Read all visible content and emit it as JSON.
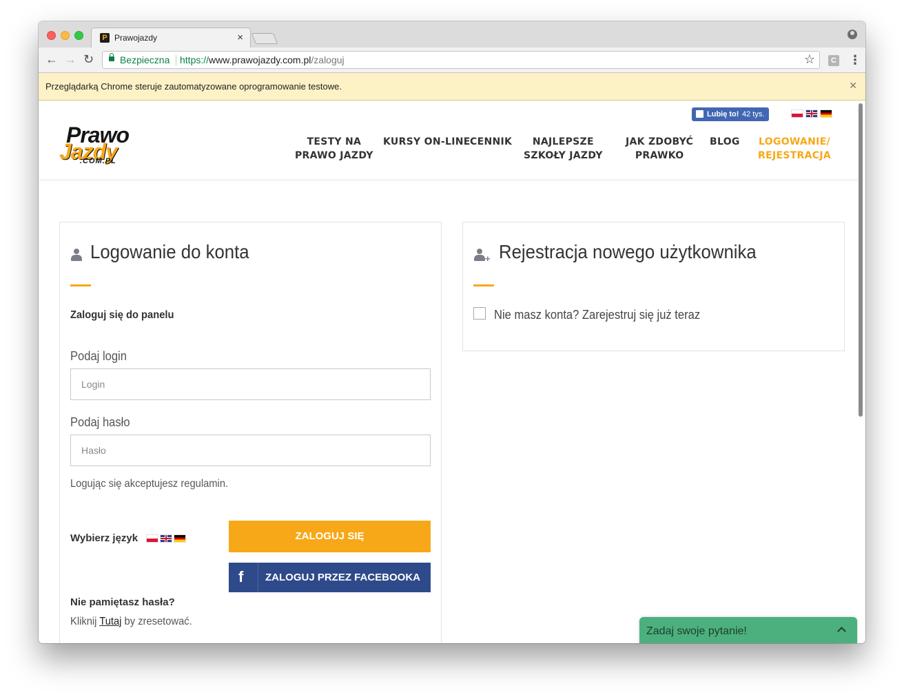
{
  "browser": {
    "tab_title": "Prawojazdy",
    "favicon_letter": "P",
    "secure_label": "Bezpieczna",
    "url_scheme": "https://",
    "url_host": "www.prawojazdy.com.pl",
    "url_path": "/zaloguj",
    "extension_letter": "C",
    "infobar_text": "Przeglądarką Chrome steruje zautomatyzowane oprogramowanie testowe."
  },
  "header": {
    "like_label": "Lubię to!",
    "like_count": "42 tys.",
    "logo_top": "Prawo",
    "logo_bottom": "Jazdy",
    "logo_domain": ".COM.PL",
    "nav": [
      {
        "label": "TESTY NA\nPRAWO JAZDY"
      },
      {
        "label": "KURSY ON-LINE"
      },
      {
        "label": "CENNIK"
      },
      {
        "label": "NAJLEPSZE\nSZKOŁY JAZDY"
      },
      {
        "label": "JAK ZDOBYĆ\nPRAWKO"
      },
      {
        "label": "BLOG"
      },
      {
        "label": "LOGOWANIE/\nREJESTRACJA"
      }
    ]
  },
  "login": {
    "title": "Logowanie do konta",
    "subtitle": "Zaloguj się do panelu",
    "login_label": "Podaj login",
    "login_placeholder": "Login",
    "password_label": "Podaj hasło",
    "password_placeholder": "Hasło",
    "terms": "Logując się akceptujesz regulamin.",
    "language_label": "Wybierz język",
    "submit": "ZALOGUJ SIĘ",
    "facebook": "ZALOGUJ PRZEZ FACEBOOKA",
    "forgot_title": "Nie pamiętasz hasła?",
    "forgot_prefix": "Kliknij ",
    "forgot_link": "Tutaj",
    "forgot_suffix": " by zresetować."
  },
  "register": {
    "title": "Rejestracja nowego użytkownika",
    "checkbox_label": "Nie masz konta? Zarejestruj się już teraz"
  },
  "chat": {
    "label": "Zadaj swoje pytanie!"
  },
  "colors": {
    "accent": "#f7a818",
    "facebook": "#2f4a8a",
    "chat": "#4cb07e"
  }
}
